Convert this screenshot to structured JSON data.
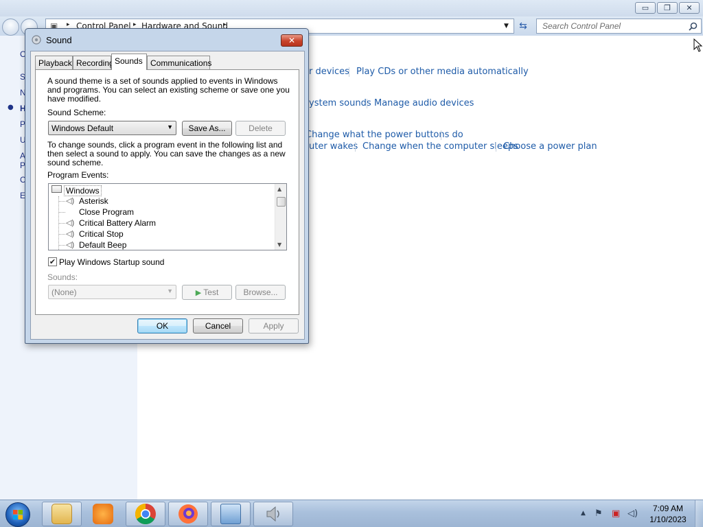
{
  "control_panel": {
    "breadcrumbs": [
      "Control Panel",
      "Hardware and Sound"
    ],
    "search_placeholder": "Search Control Panel",
    "window_controls": {
      "minimize": "▭",
      "restore": "❐",
      "close": "✕"
    },
    "sidebar_fragments": [
      "C",
      "S",
      "N",
      "H",
      "P",
      "U",
      "A",
      "P",
      "C",
      "E"
    ],
    "links": [
      "r devices",
      "Play CDs or other media automatically",
      "ystem sounds",
      "Manage audio devices",
      "Change what the power buttons do",
      "uter wakes",
      "Change when the computer sleeps",
      "Choose a power plan"
    ]
  },
  "dialog": {
    "title": "Sound",
    "close_label": "✕",
    "tabs": [
      "Playback",
      "Recording",
      "Sounds",
      "Communications"
    ],
    "active_tab": "Sounds",
    "intro_lines": [
      "A sound theme is a set of sounds applied to events in Windows",
      "and programs.  You can select an existing scheme or save one you",
      "have modified."
    ],
    "scheme_label": "Sound Scheme:",
    "scheme_value": "Windows Default",
    "save_as_label": "Save As...",
    "delete_label": "Delete",
    "instructions_lines": [
      "To change sounds, click a program event in the following list and",
      "then select a sound to apply.  You can save the changes as a new",
      "sound scheme."
    ],
    "events_label": "Program Events:",
    "events_root": "Windows",
    "events": [
      {
        "label": "Asterisk",
        "has_sound": true
      },
      {
        "label": "Close Program",
        "has_sound": false
      },
      {
        "label": "Critical Battery Alarm",
        "has_sound": true
      },
      {
        "label": "Critical Stop",
        "has_sound": true
      },
      {
        "label": "Default Beep",
        "has_sound": true
      }
    ],
    "startup_checkbox_label": "Play Windows Startup sound",
    "startup_checked": true,
    "sounds_label": "Sounds:",
    "sound_value": "(None)",
    "test_label": "Test",
    "browse_label": "Browse...",
    "ok_label": "OK",
    "cancel_label": "Cancel",
    "apply_label": "Apply"
  },
  "taskbar": {
    "apps": [
      "windows-explorer",
      "media-player",
      "chrome",
      "firefox",
      "control-panel",
      "sound"
    ],
    "clock_time": "7:09 AM",
    "clock_date": "1/10/2023",
    "tray_expand": "▲"
  }
}
